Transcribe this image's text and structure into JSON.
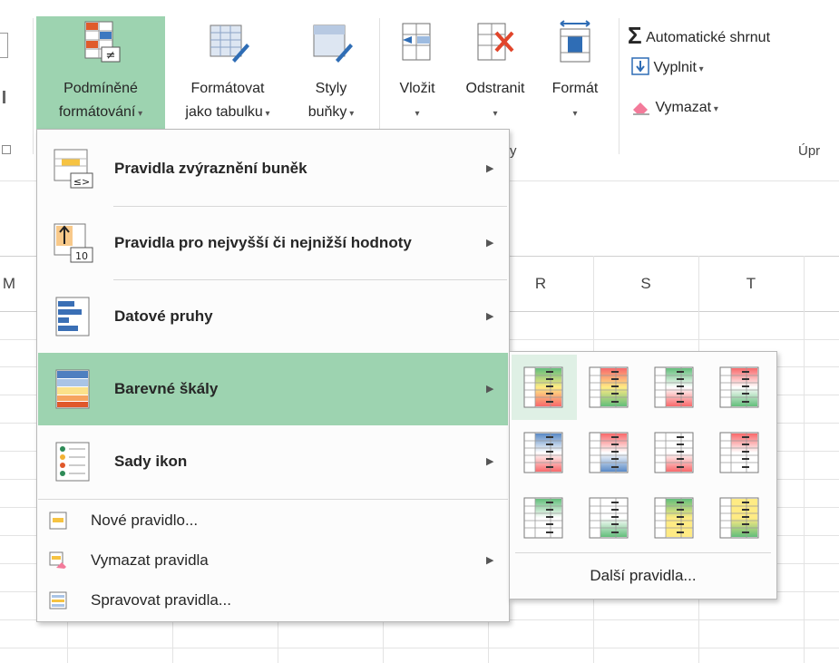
{
  "ribbon": {
    "buttons": [
      {
        "line1": "Podmíněné",
        "line2": "formátování",
        "icon": "conditional-formatting-icon"
      },
      {
        "line1": "Formátovat",
        "line2": "jako tabulku",
        "icon": "format-as-table-icon"
      },
      {
        "line1": "Styly",
        "line2": "buňky",
        "icon": "cell-styles-icon"
      },
      {
        "line1": "Vložit",
        "line2": "",
        "icon": "insert-cells-icon"
      },
      {
        "line1": "Odstranit",
        "line2": "",
        "icon": "delete-cells-icon"
      },
      {
        "line1": "Formát",
        "line2": "",
        "icon": "format-cells-icon"
      }
    ],
    "editing": {
      "autosum": "Automatické shrnut",
      "fill": "Vyplnit",
      "clear": "Vymazat",
      "group_label": "Úpr"
    },
    "cells_group_label_tail": "y"
  },
  "sheet": {
    "columns": [
      "M",
      "R",
      "S",
      "T"
    ]
  },
  "menu": {
    "items": [
      {
        "label": "Pravidla zvýraznění buněk",
        "icon": "highlight-cells-rules-icon"
      },
      {
        "label": "Pravidla pro nejvyšší či nejnižší hodnoty",
        "icon": "top-bottom-rules-icon"
      },
      {
        "label": "Datové pruhy",
        "icon": "data-bars-icon"
      },
      {
        "label": "Barevné škály",
        "icon": "color-scales-icon"
      },
      {
        "label": "Sady ikon",
        "icon": "icon-sets-icon"
      }
    ],
    "simple_items": [
      {
        "label": "Nové pravidlo...",
        "icon": "new-rule-icon"
      },
      {
        "label": "Vymazat pravidla",
        "icon": "clear-rules-icon"
      },
      {
        "label": "Spravovat pravidla...",
        "icon": "manage-rules-icon"
      }
    ]
  },
  "submenu": {
    "more_label": "Další pravidla...",
    "scales": [
      [
        "#63be7b",
        "#ffeb84",
        "#f8696b"
      ],
      [
        "#f8696b",
        "#ffeb84",
        "#63be7b"
      ],
      [
        "#63be7b",
        "#ffffff",
        "#f8696b"
      ],
      [
        "#f8696b",
        "#ffffff",
        "#63be7b"
      ],
      [
        "#5a8ac6",
        "#ffffff",
        "#f8696b"
      ],
      [
        "#f8696b",
        "#ffffff",
        "#5a8ac6"
      ],
      [
        "#ffffff",
        "#ffffff",
        "#f8696b"
      ],
      [
        "#f8696b",
        "#ffffff",
        "#ffffff"
      ],
      [
        "#63be7b",
        "#ffffff",
        "#ffffff"
      ],
      [
        "#ffffff",
        "#ffffff",
        "#63be7b"
      ],
      [
        "#63be7b",
        "#ffeb84",
        "#ffeb84"
      ],
      [
        "#ffeb84",
        "#ffeb84",
        "#63be7b"
      ]
    ]
  }
}
